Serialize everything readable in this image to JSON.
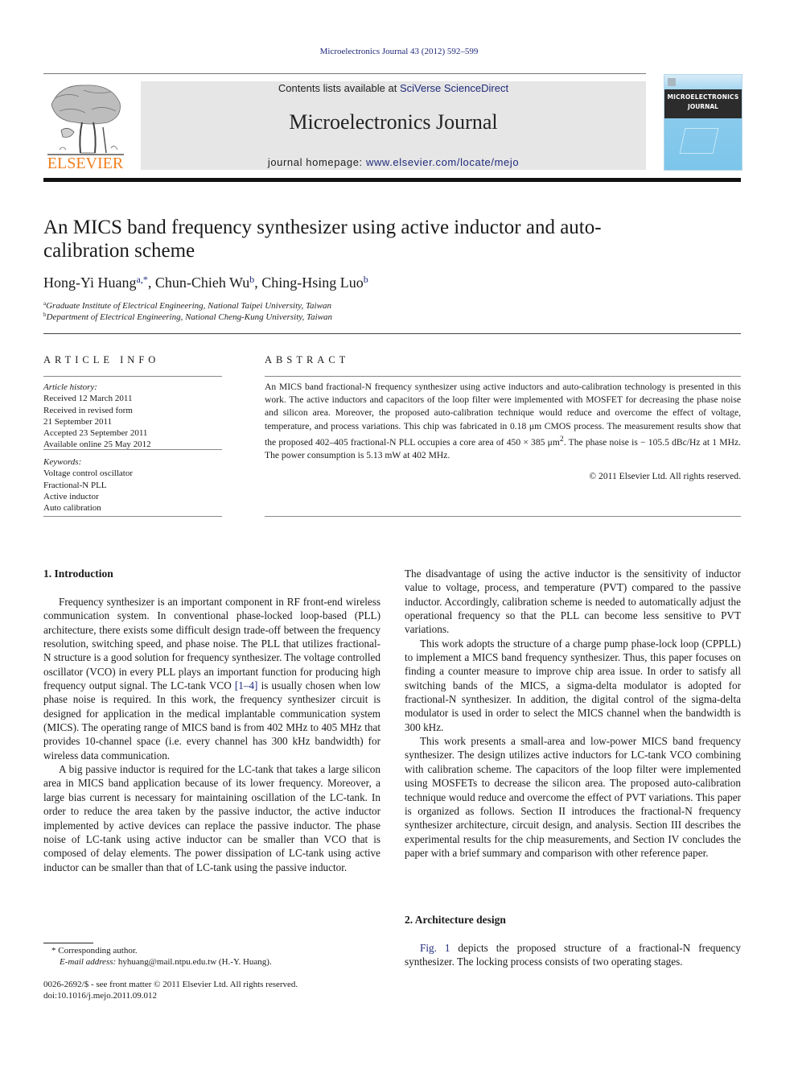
{
  "header": {
    "citation": "Microelectronics Journal 43 (2012) 592–599",
    "publisher_logo_text": "ELSEVIER",
    "contents_prefix": "Contents lists available at ",
    "contents_link": "SciVerse ScienceDirect",
    "journal_name": "Microelectronics Journal",
    "homepage_prefix": "journal homepage: ",
    "homepage_link": "www.elsevier.com/locate/mejo",
    "cover_title_line1": "MICROELECTRONICS",
    "cover_title_line2": "JOURNAL",
    "colors": {
      "publisher_orange": "#f07f1e",
      "link_blue": "#1f2a7a",
      "banner_gray": "#e6e6e6",
      "cover_blue": "#7cc5ea"
    }
  },
  "article": {
    "title": "An MICS band frequency synthesizer using active inductor and auto-calibration scheme",
    "authors": [
      {
        "name": "Hong-Yi Huang",
        "sup": "a,*",
        "sep": ", "
      },
      {
        "name": "Chun-Chieh Wu",
        "sup": "b",
        "sep": ", "
      },
      {
        "name": "Ching-Hsing Luo",
        "sup": "b",
        "sep": ""
      }
    ],
    "affiliations": [
      {
        "mark": "a",
        "text": "Graduate Institute of Electrical Engineering, National Taipei University, Taiwan"
      },
      {
        "mark": "b",
        "text": "Department of Electrical Engineering, National Cheng-Kung University, Taiwan"
      }
    ]
  },
  "article_info": {
    "heading": "ARTICLE INFO",
    "history_label": "Article history:",
    "history": [
      "Received 12 March 2011",
      "Received in revised form",
      "21 September 2011",
      "Accepted 23 September 2011",
      "Available online 25 May 2012"
    ],
    "keywords_label": "Keywords:",
    "keywords": [
      "Voltage control oscillator",
      "Fractional-N PLL",
      "Active inductor",
      "Auto calibration"
    ]
  },
  "abstract": {
    "heading": "ABSTRACT",
    "text_part1": "An MICS band fractional-N frequency synthesizer using active inductors and auto-calibration technology is presented in this work. The active inductors and capacitors of the loop filter were implemented with MOSFET for decreasing the phase noise and silicon area. Moreover, the proposed auto-calibration technique would reduce and overcome the effect of voltage, temperature, and process variations. This chip was fabricated in 0.18 μm CMOS process. The measurement results show that the proposed 402–405 fractional-N PLL occupies a core area of 450 × 385 μm",
    "text_sup": "2",
    "text_part2": ". The phase noise is  − 105.5 dBc/Hz at 1 MHz. The power consumption is 5.13 mW at 402 MHz.",
    "copyright": "© 2011 Elsevier Ltd. All rights reserved."
  },
  "sections": {
    "intro_heading": "1.  Introduction",
    "intro_p1_a": "Frequency synthesizer is an important component in RF front-end wireless communication system. In conventional phase-locked loop-based (PLL) architecture, there exists some difficult design trade-off between the frequency resolution, switching speed, and phase noise. The PLL that utilizes fractional-N structure is a good solution for frequency synthesizer. The voltage controlled oscillator (VCO) in every PLL plays an important function for producing high frequency output signal. The LC-tank VCO ",
    "intro_p1_ref": "[1–4]",
    "intro_p1_b": " is usually chosen when low phase noise is required. In this work, the frequency synthesizer circuit is designed for application in the medical implantable communication system (MICS). The operating range of MICS band is from 402 MHz to 405 MHz that provides 10-channel space (i.e. every channel has 300 kHz bandwidth) for wireless data communication.",
    "intro_p2": "A big passive inductor is required for the LC-tank that takes a large silicon area in MICS band application because of its lower frequency. Moreover, a large bias current is necessary for maintaining oscillation of the LC-tank. In order to reduce the area taken by the passive inductor, the active inductor implemented by active devices can replace the passive inductor. The phase noise of LC-tank using active inductor can be smaller than VCO that is composed of delay elements. The power dissipation of LC-tank using active inductor can be smaller than that of LC-tank using the passive inductor.",
    "intro_p3": "The disadvantage of using the active inductor is the sensitivity of inductor value to voltage, process, and temperature (PVT) compared to the passive inductor. Accordingly, calibration scheme is needed to automatically adjust the operational frequency so that the PLL can become less sensitive to PVT variations.",
    "intro_p4": "This work adopts the structure of a charge pump phase-lock loop (CPPLL) to implement a MICS band frequency synthesizer. Thus, this paper focuses on finding a counter measure to improve chip area issue. In order to satisfy all switching bands of the MICS, a sigma-delta modulator is adopted for fractional-N synthesizer. In addition, the digital control of the sigma-delta modulator is used in order to select the MICS channel when the bandwidth is 300 kHz.",
    "intro_p5": "This work presents a small-area and low-power MICS band frequency synthesizer. The design utilizes active inductors for LC-tank VCO combining with calibration scheme. The capacitors of the loop filter were implemented using MOSFETs to decrease the silicon area. The proposed auto-calibration technique would reduce and overcome the effect of PVT variations. This paper is organized as follows. Section II introduces the fractional-N frequency synthesizer architecture, circuit design, and analysis. Section III describes the experimental results for the chip measurements, and Section IV concludes the paper with a brief summary and comparison with other reference paper.",
    "arch_heading": "2.  Architecture design",
    "arch_p1_ref": "Fig. 1",
    "arch_p1": " depicts the proposed structure of a fractional-N frequency synthesizer. The locking process consists of two operating stages."
  },
  "footnotes": {
    "corresponding": "* Corresponding author.",
    "email_label": "E-mail address:",
    "email": " hyhuang@mail.ntpu.edu.tw (H.-Y. Huang).",
    "issn": "0026-2692/$ - see front matter © 2011 Elsevier Ltd. All rights reserved.",
    "doi": "doi:10.1016/j.mejo.2011.09.012"
  }
}
